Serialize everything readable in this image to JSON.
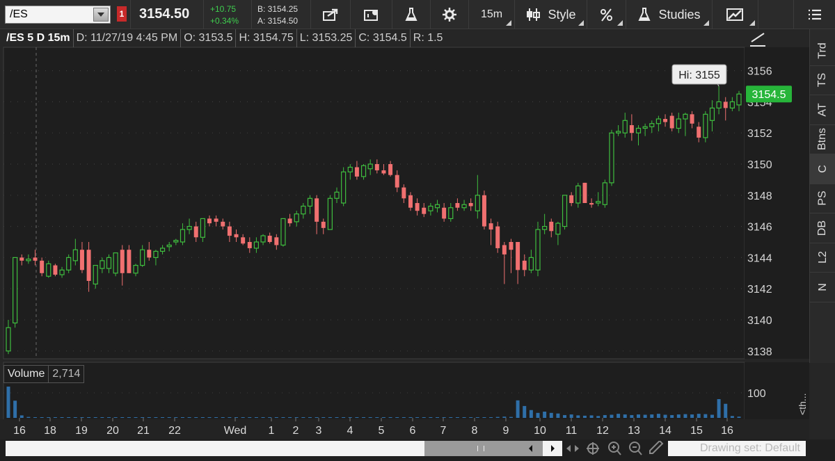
{
  "toolbar": {
    "symbol": "/ES",
    "alert_flag": "1",
    "last_price": "3154.50",
    "change_abs": "+10.75",
    "change_pct": "+0.34%",
    "bid": "B: 3154.25",
    "ask": "A: 3154.50",
    "aggregation": "15m",
    "style_label": "Style",
    "studies_label": "Studies"
  },
  "info_bar": {
    "symbol_period": "/ES 5 D 15m",
    "date": "D: 11/27/19 4:45 PM",
    "open": "O: 3153.5",
    "high": "H: 3154.75",
    "low": "L: 3153.25",
    "close": "C: 3154.5",
    "range": "R: 1.5"
  },
  "volume_panel": {
    "label": "Volume",
    "value": "2,714",
    "axis_label": "100"
  },
  "right_tabs": [
    "Trd",
    "TS",
    "AT",
    "Btns",
    "C",
    "PS",
    "DB",
    "L2",
    "N"
  ],
  "th_label": "<th...",
  "drawing_set": "Drawing set: Default",
  "colors": {
    "up": "#3fbf3f",
    "down": "#f07070",
    "volume": "#2f6fa8",
    "background": "#1e1e1e",
    "price_bubble": "#27b53a"
  },
  "chart_data": {
    "type": "candlestick",
    "symbol": "/ES",
    "interval": "15m",
    "ylim": [
      3137.5,
      3157.5
    ],
    "y_ticks": [
      3138,
      3140,
      3142,
      3144,
      3146,
      3148,
      3150,
      3152,
      3154,
      3156
    ],
    "x_labels": [
      "16",
      "18",
      "19",
      "20",
      "21",
      "22",
      "Wed",
      "1",
      "2",
      "3",
      "4",
      "5",
      "6",
      "7",
      "8",
      "9",
      "10",
      "11",
      "12",
      "13",
      "14",
      "15",
      "16"
    ],
    "high_annotation": "Hi: 3155",
    "current_price_label": "3154.5",
    "current_price": 3154.5,
    "candles": [
      [
        3138.0,
        3140.0,
        3137.8,
        3139.5
      ],
      [
        3139.8,
        3144.0,
        3139.5,
        3144.0
      ],
      [
        3144.0,
        3144.2,
        3143.5,
        3143.8
      ],
      [
        3143.8,
        3144.2,
        3143.6,
        3143.9
      ],
      [
        3144.0,
        3144.5,
        3143.5,
        3143.8
      ],
      [
        3143.8,
        3144.0,
        3142.8,
        3143.0
      ],
      [
        3142.8,
        3143.8,
        3142.7,
        3143.6
      ],
      [
        3143.5,
        3143.6,
        3142.8,
        3142.9
      ],
      [
        3142.9,
        3143.4,
        3142.7,
        3143.2
      ],
      [
        3143.2,
        3144.2,
        3143.0,
        3144.0
      ],
      [
        3143.8,
        3145.2,
        3143.5,
        3144.5
      ],
      [
        3144.5,
        3145.0,
        3143.0,
        3143.2
      ],
      [
        3144.5,
        3145.0,
        3141.8,
        3142.5
      ],
      [
        3142.3,
        3143.5,
        3142.0,
        3143.5
      ],
      [
        3143.3,
        3144.0,
        3143.0,
        3143.8
      ],
      [
        3143.3,
        3144.2,
        3143.0,
        3144.0
      ],
      [
        3143.0,
        3144.3,
        3142.8,
        3144.3
      ],
      [
        3144.5,
        3144.8,
        3142.2,
        3143.0
      ],
      [
        3144.5,
        3144.8,
        3143.0,
        3143.0
      ],
      [
        3143.0,
        3143.6,
        3142.8,
        3143.5
      ],
      [
        3143.5,
        3144.8,
        3143.4,
        3144.5
      ],
      [
        3144.5,
        3145.0,
        3143.8,
        3144.0
      ],
      [
        3144.0,
        3144.5,
        3143.5,
        3144.4
      ],
      [
        3144.4,
        3144.8,
        3144.2,
        3144.6
      ],
      [
        3144.7,
        3145.0,
        3144.4,
        3144.8
      ],
      [
        3145.0,
        3145.2,
        3144.8,
        3145.1
      ],
      [
        3145.0,
        3146.2,
        3144.8,
        3145.8
      ],
      [
        3145.8,
        3146.5,
        3145.5,
        3146.0
      ],
      [
        3146.0,
        3146.3,
        3145.0,
        3145.3
      ],
      [
        3145.3,
        3146.5,
        3145.0,
        3146.5
      ],
      [
        3146.5,
        3146.7,
        3146.0,
        3146.2
      ],
      [
        3146.5,
        3146.7,
        3146.0,
        3146.3
      ],
      [
        3146.3,
        3146.5,
        3145.8,
        3146.0
      ],
      [
        3146.0,
        3146.3,
        3145.0,
        3145.4
      ],
      [
        3145.5,
        3145.8,
        3145.0,
        3145.3
      ],
      [
        3145.3,
        3145.5,
        3144.8,
        3144.9
      ],
      [
        3145.0,
        3145.3,
        3144.3,
        3144.6
      ],
      [
        3144.6,
        3145.3,
        3144.3,
        3145.0
      ],
      [
        3145.0,
        3145.5,
        3144.8,
        3145.4
      ],
      [
        3145.4,
        3145.6,
        3144.9,
        3145.0
      ],
      [
        3145.3,
        3145.5,
        3144.5,
        3144.8
      ],
      [
        3144.8,
        3146.5,
        3144.7,
        3146.5
      ],
      [
        3146.5,
        3146.8,
        3146.0,
        3146.2
      ],
      [
        3146.3,
        3147.0,
        3146.0,
        3146.8
      ],
      [
        3146.8,
        3147.5,
        3146.5,
        3147.3
      ],
      [
        3147.3,
        3148.0,
        3146.8,
        3147.8
      ],
      [
        3147.8,
        3148.0,
        3145.5,
        3146.3
      ],
      [
        3146.3,
        3146.5,
        3145.5,
        3145.9
      ],
      [
        3145.8,
        3148.0,
        3145.8,
        3147.8
      ],
      [
        3147.8,
        3148.5,
        3147.5,
        3148.2
      ],
      [
        3147.5,
        3149.8,
        3147.3,
        3149.5
      ],
      [
        3149.5,
        3150.0,
        3149.0,
        3149.8
      ],
      [
        3149.8,
        3150.2,
        3149.0,
        3149.2
      ],
      [
        3149.2,
        3150.0,
        3149.0,
        3149.9
      ],
      [
        3149.7,
        3150.3,
        3149.3,
        3150.0
      ],
      [
        3150.0,
        3150.3,
        3149.4,
        3149.6
      ],
      [
        3149.6,
        3150.0,
        3149.3,
        3149.4
      ],
      [
        3150.0,
        3150.2,
        3149.2,
        3149.3
      ],
      [
        3149.3,
        3149.6,
        3148.2,
        3148.5
      ],
      [
        3148.5,
        3148.7,
        3147.5,
        3147.8
      ],
      [
        3148.0,
        3148.2,
        3147.0,
        3147.2
      ],
      [
        3147.5,
        3147.8,
        3146.7,
        3147.0
      ],
      [
        3147.2,
        3147.5,
        3146.6,
        3146.8
      ],
      [
        3147.0,
        3147.5,
        3146.7,
        3147.3
      ],
      [
        3147.2,
        3147.7,
        3146.9,
        3147.4
      ],
      [
        3147.2,
        3147.5,
        3146.3,
        3146.5
      ],
      [
        3146.5,
        3147.5,
        3146.3,
        3147.2
      ],
      [
        3147.5,
        3147.8,
        3147.0,
        3147.2
      ],
      [
        3147.2,
        3147.7,
        3147.0,
        3147.4
      ],
      [
        3147.5,
        3147.8,
        3147.0,
        3147.3
      ],
      [
        3147.0,
        3149.3,
        3146.5,
        3148.0
      ],
      [
        3148.0,
        3148.3,
        3145.8,
        3146.0
      ],
      [
        3146.2,
        3146.5,
        3144.8,
        3145.8
      ],
      [
        3146.0,
        3146.3,
        3144.3,
        3144.6
      ],
      [
        3144.8,
        3145.0,
        3142.3,
        3144.2
      ],
      [
        3145.0,
        3145.2,
        3143.0,
        3144.5
      ],
      [
        3145.0,
        3145.0,
        3142.3,
        3143.2
      ],
      [
        3143.8,
        3144.2,
        3142.8,
        3143.2
      ],
      [
        3143.2,
        3144.5,
        3143.0,
        3144.0
      ],
      [
        3143.2,
        3146.3,
        3142.8,
        3145.8
      ],
      [
        3145.8,
        3146.8,
        3145.5,
        3146.0
      ],
      [
        3146.3,
        3146.5,
        3145.3,
        3145.7
      ],
      [
        3145.5,
        3146.3,
        3144.8,
        3146.2
      ],
      [
        3146.0,
        3148.0,
        3145.8,
        3148.0
      ],
      [
        3148.0,
        3148.2,
        3147.3,
        3147.5
      ],
      [
        3147.5,
        3148.8,
        3147.2,
        3148.6
      ],
      [
        3148.8,
        3148.8,
        3147.5,
        3147.5
      ],
      [
        3147.5,
        3147.8,
        3147.2,
        3147.4
      ],
      [
        3147.5,
        3148.2,
        3147.3,
        3147.6
      ],
      [
        3147.4,
        3149.0,
        3147.2,
        3148.8
      ],
      [
        3148.8,
        3152.2,
        3148.6,
        3152.0
      ],
      [
        3152.0,
        3152.5,
        3151.8,
        3152.1
      ],
      [
        3152.0,
        3153.3,
        3151.7,
        3152.8
      ],
      [
        3152.5,
        3153.2,
        3151.5,
        3152.0
      ],
      [
        3152.0,
        3152.5,
        3151.2,
        3152.3
      ],
      [
        3152.3,
        3152.6,
        3151.8,
        3152.4
      ],
      [
        3152.4,
        3152.8,
        3152.0,
        3152.6
      ],
      [
        3152.6,
        3153.1,
        3152.1,
        3152.9
      ],
      [
        3152.9,
        3153.2,
        3152.4,
        3152.7
      ],
      [
        3153.1,
        3153.3,
        3152.1,
        3152.3
      ],
      [
        3152.3,
        3153.3,
        3152.0,
        3152.9
      ],
      [
        3152.9,
        3153.3,
        3151.8,
        3153.2
      ],
      [
        3153.2,
        3153.4,
        3152.3,
        3152.6
      ],
      [
        3152.4,
        3152.7,
        3151.4,
        3151.7
      ],
      [
        3151.7,
        3153.4,
        3151.4,
        3153.2
      ],
      [
        3152.8,
        3154.1,
        3152.1,
        3153.6
      ],
      [
        3153.6,
        3155.0,
        3153.2,
        3154.0
      ],
      [
        3154.0,
        3154.3,
        3152.8,
        3153.6
      ],
      [
        3153.6,
        3154.3,
        3153.4,
        3154.0
      ],
      [
        3153.8,
        3154.7,
        3153.4,
        3154.5
      ]
    ],
    "volume_max": 100,
    "volume": [
      100,
      55,
      8,
      3,
      2,
      1,
      1,
      1,
      2,
      1,
      1,
      1,
      1,
      1,
      1,
      1,
      1,
      1,
      1,
      1,
      1,
      1,
      1,
      1,
      1,
      1,
      1,
      1,
      1,
      1,
      1,
      1,
      1,
      1,
      1,
      1,
      1,
      1,
      1,
      1,
      1,
      1,
      1,
      1,
      1,
      1,
      1,
      1,
      1,
      1,
      1,
      1,
      1,
      1,
      1,
      1,
      1,
      1,
      1,
      1,
      1,
      1,
      1,
      1,
      1,
      1,
      1,
      1,
      1,
      1,
      1,
      1,
      1,
      3,
      4,
      3,
      56,
      38,
      25,
      16,
      20,
      16,
      14,
      9,
      11,
      8,
      7,
      8,
      6,
      9,
      10,
      13,
      11,
      9,
      11,
      10,
      11,
      13,
      10,
      9,
      11,
      12,
      11,
      13,
      12,
      10,
      60,
      45,
      6,
      4
    ]
  }
}
